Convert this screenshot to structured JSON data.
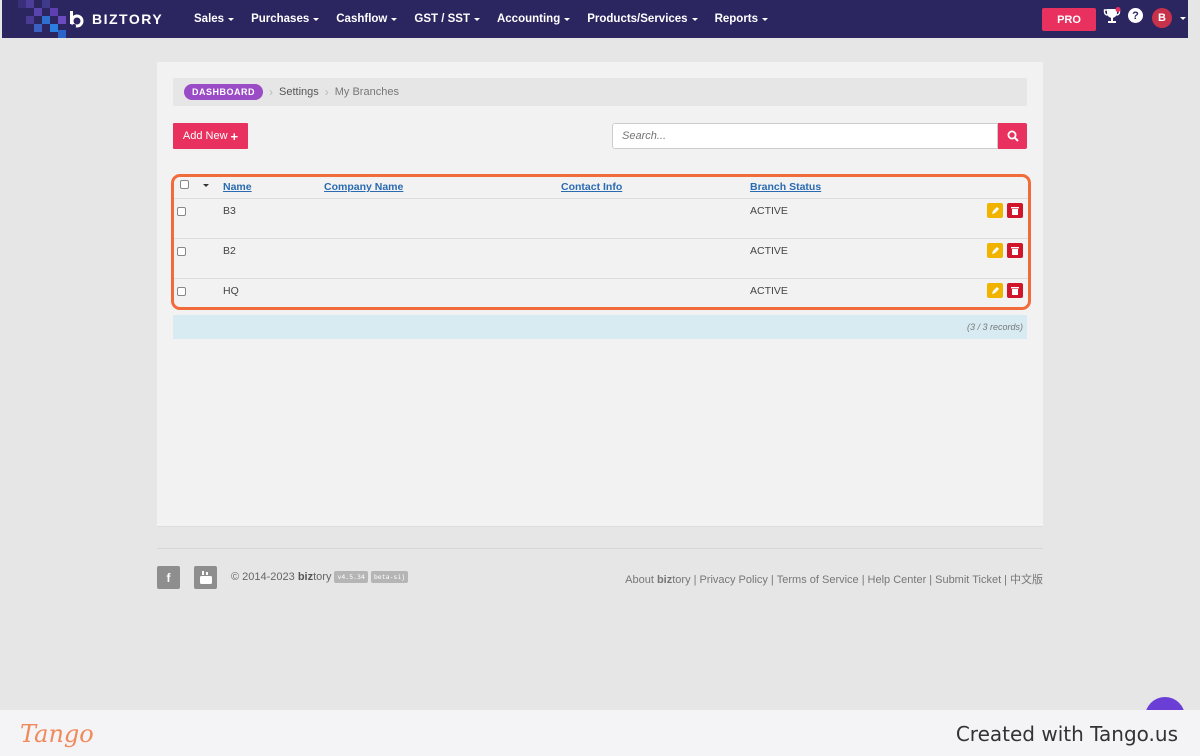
{
  "app": {
    "brand": "BIZTORY",
    "colors": {
      "nav_bg": "#2b2560",
      "accent": "#e8315f",
      "highlight": "#f26b3a",
      "dashboard_pill": "#9a4bc6"
    }
  },
  "nav": {
    "items": [
      {
        "label": "Sales"
      },
      {
        "label": "Purchases"
      },
      {
        "label": "Cashflow"
      },
      {
        "label": "GST / SST"
      },
      {
        "label": "Accounting"
      },
      {
        "label": "Products/Services"
      },
      {
        "label": "Reports"
      }
    ],
    "pro_label": "PRO",
    "trophy_icon": "trophy-icon",
    "help_icon": "?",
    "avatar_letter": "B"
  },
  "breadcrumb": {
    "dashboard": "DASHBOARD",
    "settings": "Settings",
    "current": "My Branches"
  },
  "toolbar": {
    "add_label": "Add New",
    "add_icon": "+",
    "search_placeholder": "Search..."
  },
  "table": {
    "columns": [
      "Name",
      "Company Name",
      "Contact Info",
      "Branch Status"
    ],
    "rows": [
      {
        "name": "B3",
        "company": "",
        "contact": "",
        "status": "ACTIVE"
      },
      {
        "name": "B2",
        "company": "",
        "contact": "",
        "status": "ACTIVE"
      },
      {
        "name": "HQ",
        "company": "",
        "contact": "",
        "status": "ACTIVE"
      }
    ],
    "records_text": "(3 / 3 records)"
  },
  "footer": {
    "facebook": "f",
    "copyright_prefix": "© 2014-2023",
    "brand_bold": "biz",
    "brand_rest": "tory",
    "version": "v4.5.34",
    "beta": "beta-sij",
    "links": {
      "about_prefix": "About",
      "about_bold": "biz",
      "about_rest": "tory",
      "privacy": "Privacy Policy",
      "terms": "Terms of Service",
      "help": "Help Center",
      "ticket": "Submit Ticket",
      "chinese": "中文版"
    }
  },
  "tango": {
    "logo": "Tango",
    "credit": "Created with Tango.us"
  }
}
